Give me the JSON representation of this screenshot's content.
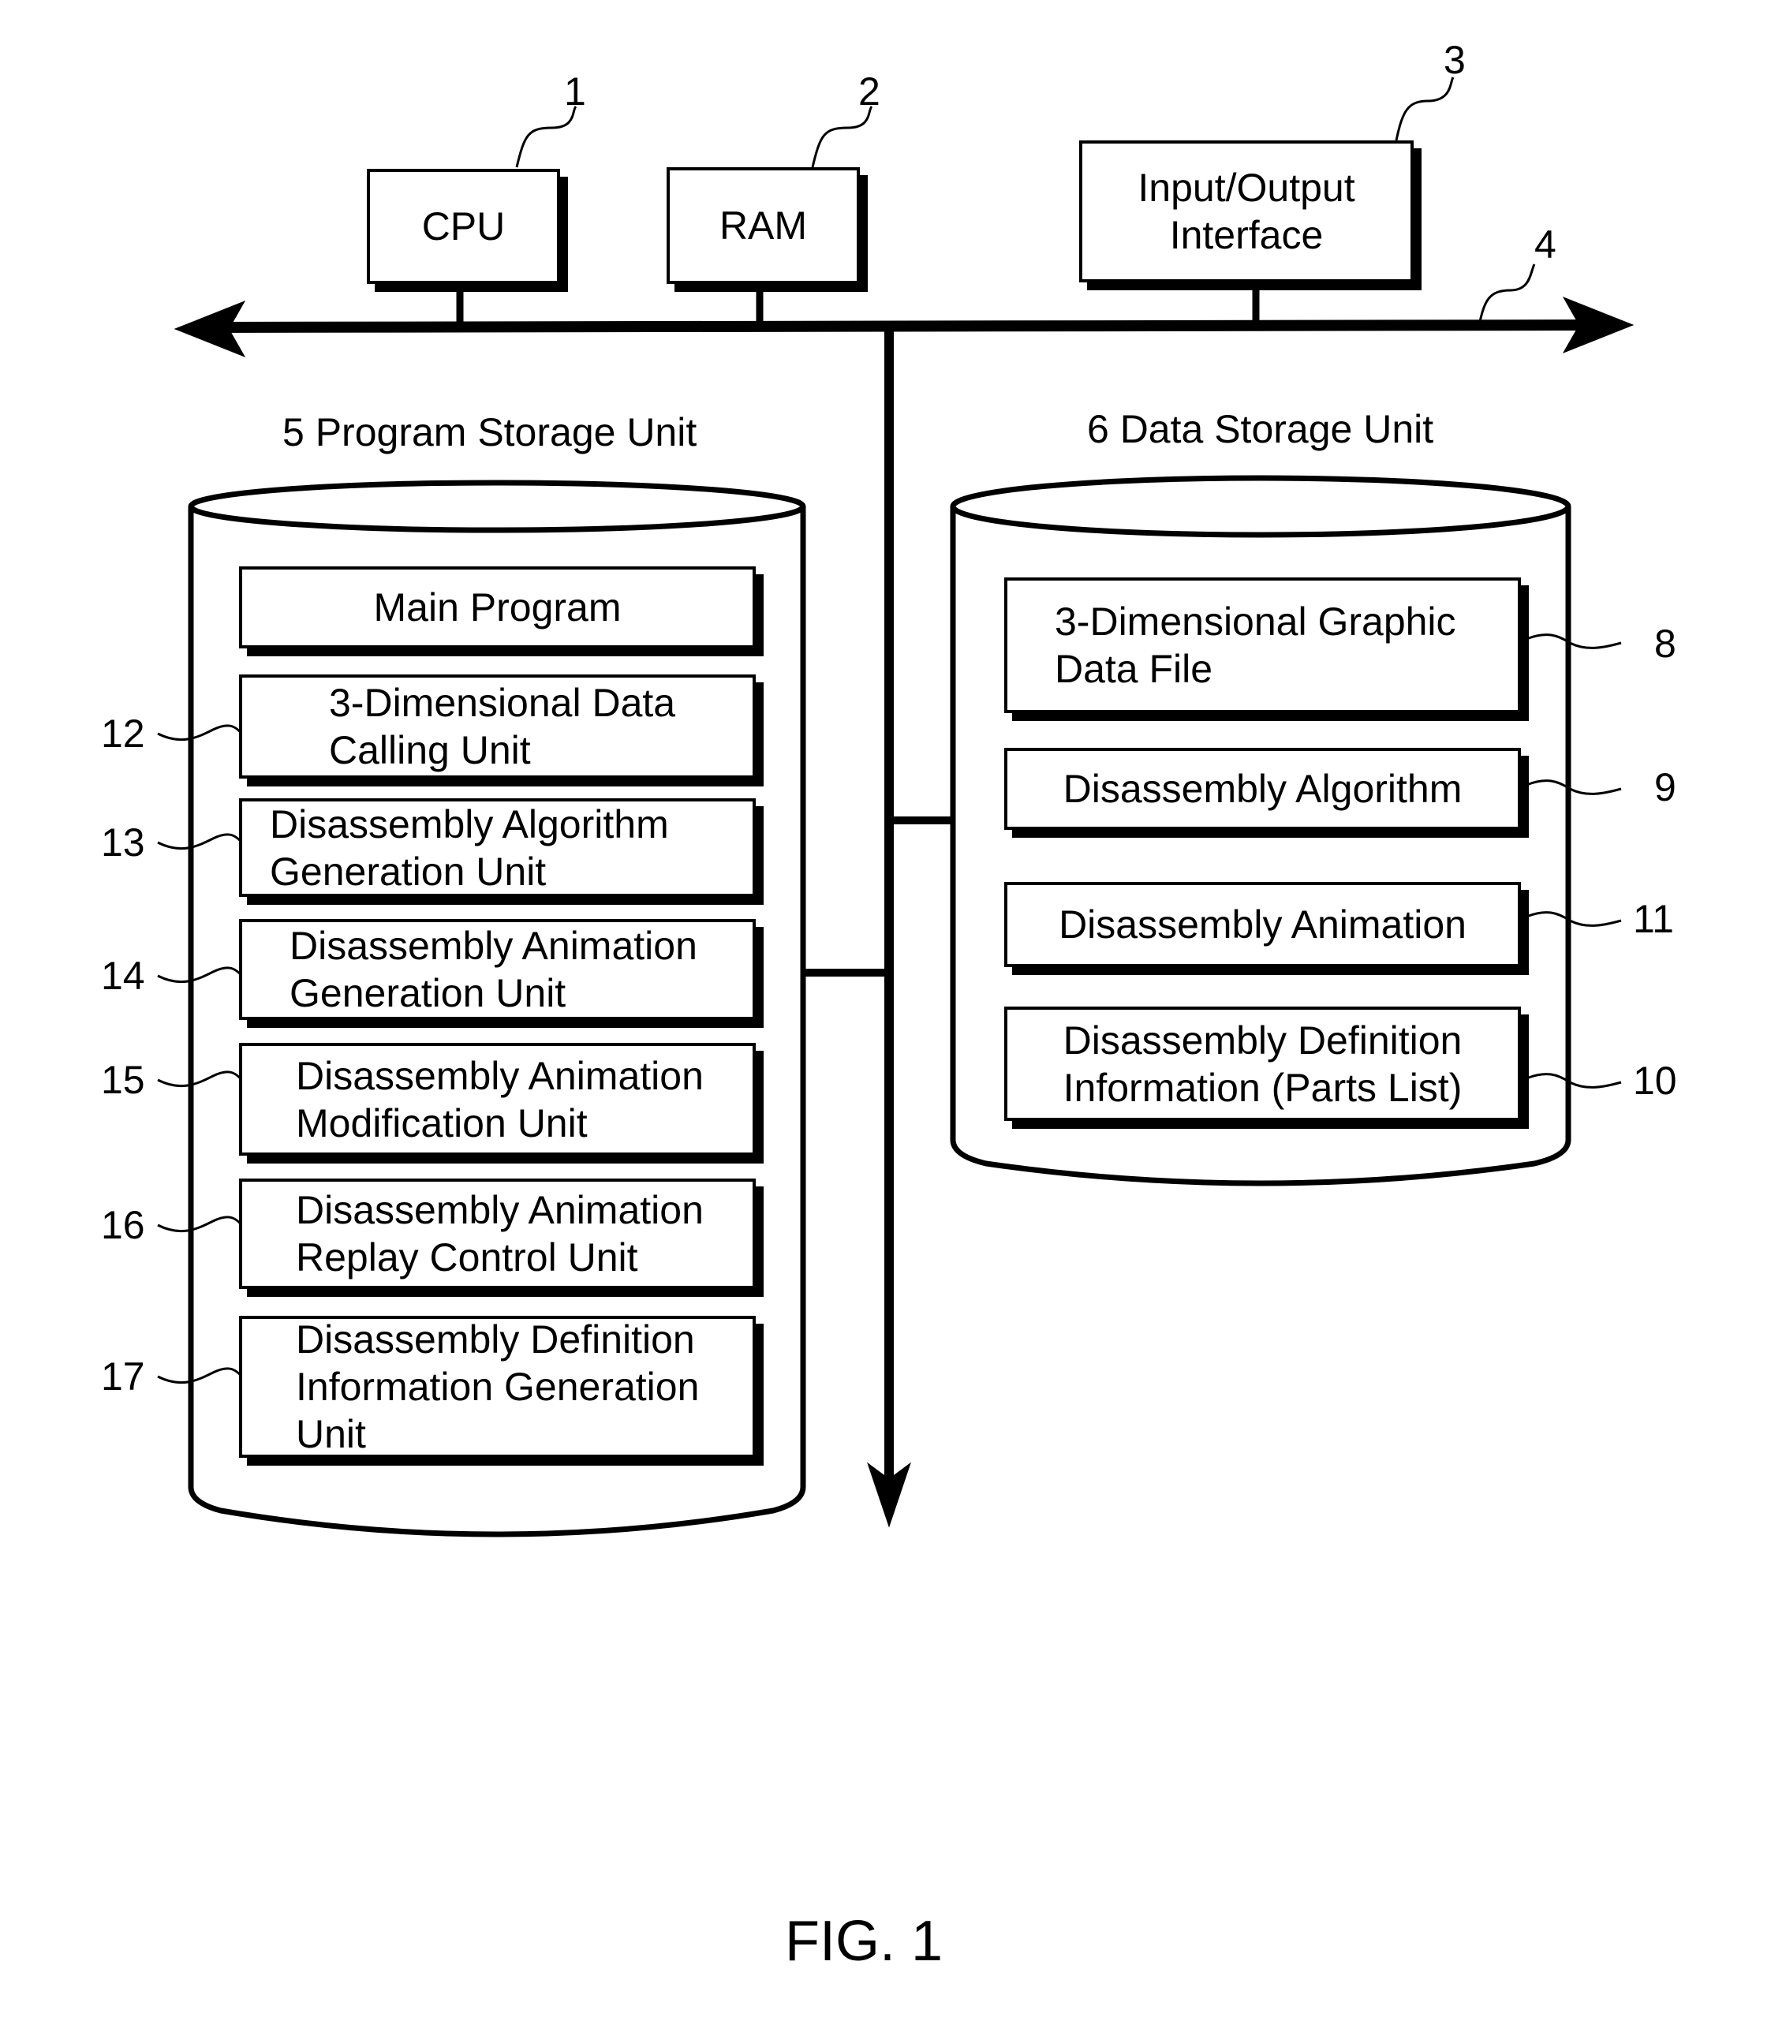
{
  "figure_label": "FIG. 1",
  "hardware": {
    "cpu": {
      "ref": "1",
      "label": "CPU"
    },
    "ram": {
      "ref": "2",
      "label": "RAM"
    },
    "io": {
      "ref": "3",
      "label": "Input/Output\nInterface"
    },
    "bus": {
      "ref": "4"
    }
  },
  "program_storage": {
    "title": "5 Program Storage Unit",
    "items": [
      {
        "ref": "",
        "label": "Main Program"
      },
      {
        "ref": "12",
        "label": "3-Dimensional Data\nCalling Unit"
      },
      {
        "ref": "13",
        "label": "Disassembly Algorithm\nGeneration Unit"
      },
      {
        "ref": "14",
        "label": "Disassembly Animation\nGeneration Unit"
      },
      {
        "ref": "15",
        "label": "Disassembly Animation\nModification Unit"
      },
      {
        "ref": "16",
        "label": "Disassembly Animation\nReplay Control Unit"
      },
      {
        "ref": "17",
        "label": "Disassembly Definition\nInformation Generation\nUnit"
      }
    ]
  },
  "data_storage": {
    "title": "6 Data Storage Unit",
    "items": [
      {
        "ref": "8",
        "label": "3-Dimensional Graphic\nData File"
      },
      {
        "ref": "9",
        "label": "Disassembly Algorithm"
      },
      {
        "ref": "11",
        "label": "Disassembly Animation"
      },
      {
        "ref": "10",
        "label": "Disassembly Definition\nInformation (Parts List)"
      }
    ]
  }
}
